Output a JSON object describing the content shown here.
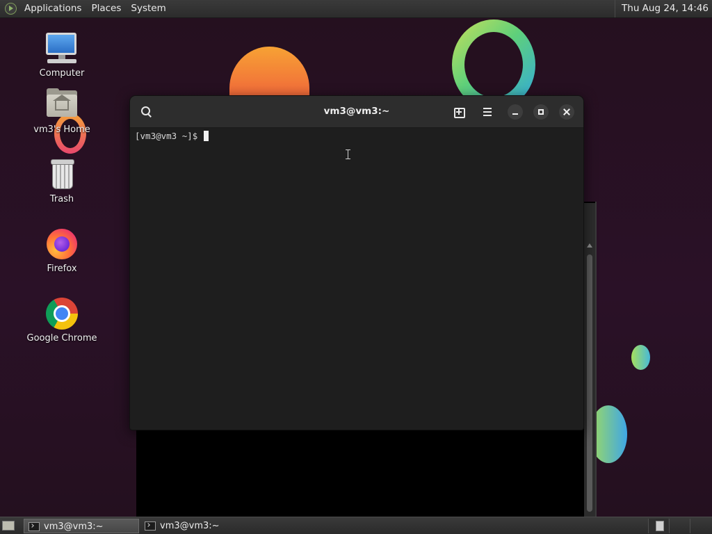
{
  "top_panel": {
    "menus": [
      "Applications",
      "Places",
      "System"
    ],
    "clock": "Thu Aug 24, 14:46"
  },
  "desktop": {
    "icons": [
      {
        "label": "Computer",
        "icon": "computer-icon"
      },
      {
        "label": "vm3's Home",
        "icon": "home-folder-icon"
      },
      {
        "label": "Trash",
        "icon": "trash-icon"
      },
      {
        "label": "Firefox",
        "icon": "firefox-icon"
      },
      {
        "label": "Google Chrome",
        "icon": "chrome-icon"
      }
    ]
  },
  "terminal": {
    "title": "vm3@vm3:~",
    "prompt": "[vm3@vm3 ~]$ ",
    "buttons": [
      "search-icon",
      "new-tab-icon",
      "hamburger-menu-icon",
      "minimize-icon",
      "maximize-icon",
      "close-icon"
    ]
  },
  "bottom_panel": {
    "tasks": [
      {
        "label": "vm3@vm3:~",
        "active": true
      },
      {
        "label": "vm3@vm3:~",
        "active": false
      }
    ],
    "workspaces": 3
  },
  "colors": {
    "desktop_bg": "#25101f",
    "panel_bg": "#2c2c2c",
    "terminal_bg": "#1e1e1e",
    "titlebar_bg": "#2d2d2d"
  }
}
